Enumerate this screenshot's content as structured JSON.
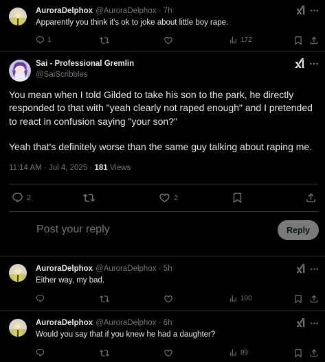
{
  "tweets": {
    "reply1": {
      "name": "AuroraDelphox",
      "handle": "@AuroraDelphox · 7h",
      "text": "Apparently you think it's ok to joke about little boy rape.",
      "replies": "1",
      "views": "172"
    },
    "main": {
      "name": "Sai - Professional Gremlin",
      "handle": "@SaiScribbles",
      "text1": "You mean when I told Gilded to take his son to the park, he directly responded to that with \"yeah clearly not raped enough\" and I pretended to react in confusion saying \"your son?\"",
      "text2": "Yeah that's definitely worse than the same guy talking about raping me.",
      "timestamp": "11:14 AM · Jul 4, 2025 · ",
      "views_count": "181",
      "views_label": " Views",
      "replies": "2",
      "likes": "2"
    },
    "composer": {
      "placeholder": "Post your reply",
      "button": "Reply"
    },
    "reply2": {
      "name": "AuroraDelphox",
      "handle": "@AuroraDelphox · 5h",
      "text": "Either way, my bad.",
      "views": "100"
    },
    "reply3": {
      "name": "AuroraDelphox",
      "handle": "@AuroraDelphox · 6h",
      "text": "Would you say that if you knew he had a daughter?",
      "views": "89"
    }
  },
  "icons": {
    "reply": "reply-bubble-icon",
    "retweet": "retweet-icon",
    "like": "heart-icon",
    "views": "views-bar-chart-icon",
    "bookmark": "bookmark-icon",
    "share": "share-icon",
    "grok": "grok-slash-icon",
    "more": "more-dots-icon"
  },
  "colors": {
    "background": "#000000",
    "text": "#e7e9ea",
    "muted": "#71767b",
    "divider": "#2f3336",
    "reply_button": "#787a7a"
  }
}
